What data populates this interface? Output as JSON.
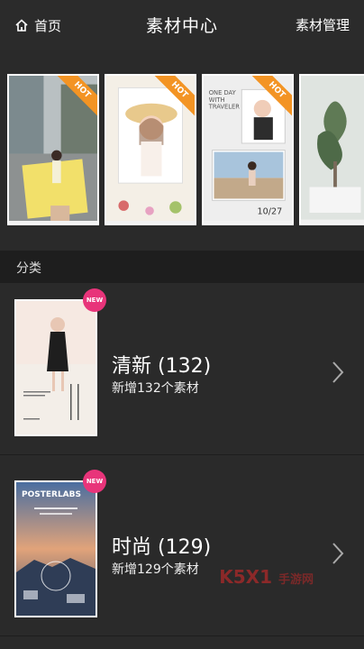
{
  "header": {
    "home_label": "首页",
    "title": "素材中心",
    "manage_label": "素材管理"
  },
  "featured": {
    "badge": "HOT"
  },
  "section": {
    "label": "分类"
  },
  "categories": [
    {
      "name": "清新 (132)",
      "sub": "新增132个素材",
      "badge": "NEW"
    },
    {
      "name": "时尚 (129)",
      "sub": "新增129个素材",
      "badge": "NEW"
    }
  ],
  "thumb_text": {
    "poster_title": "POSTERLABS",
    "card3_line1": "ONE DAY",
    "card3_line2": "WITH",
    "card3_line3": "TRAVELER",
    "card3_date": "10/27"
  },
  "watermark": {
    "main": "K5X1",
    "sub": "手游网"
  },
  "colors": {
    "background": "#2a2a2a",
    "section_bg": "#1e1e1e",
    "hot_badge": "#f39424",
    "new_badge": "#e8347a"
  }
}
